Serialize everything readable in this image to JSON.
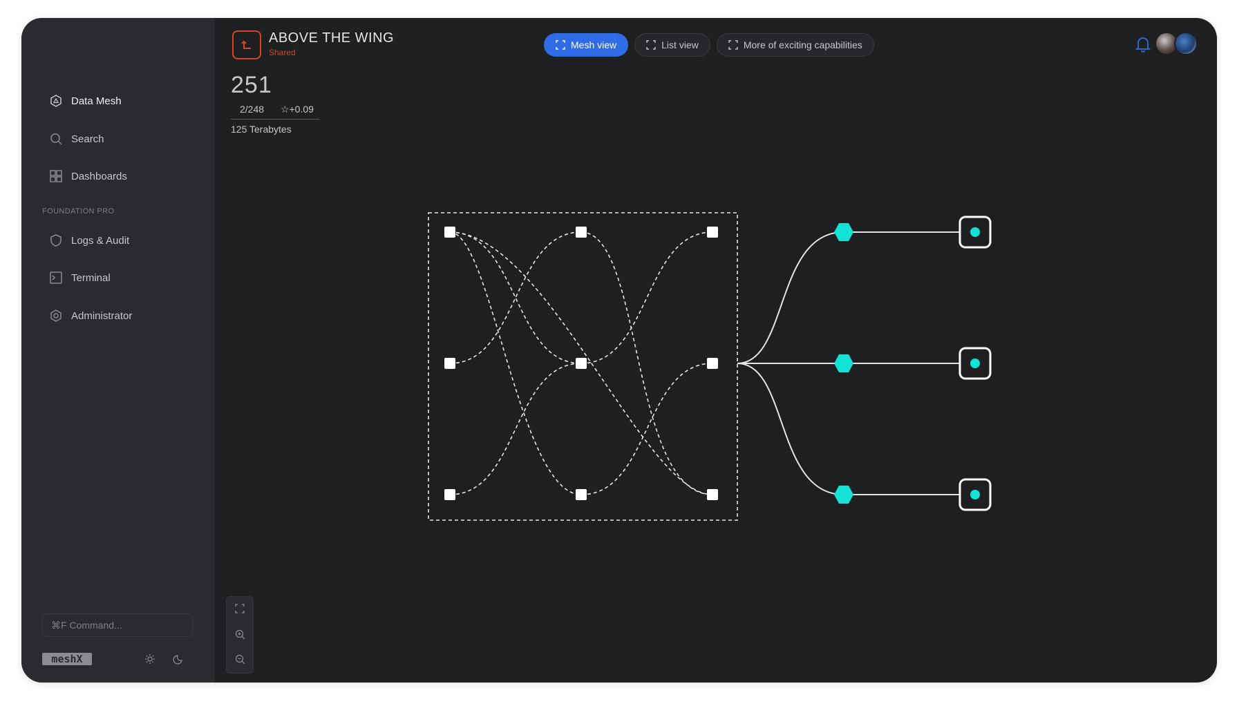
{
  "app": {
    "title": "ABOVE THE WING",
    "subtitle": "Shared",
    "accent_color": "#2f6ce5",
    "brand_color": "#d2452c",
    "node_color": "#14e2d6"
  },
  "sidebar": {
    "items": [
      {
        "label": "Data Mesh",
        "icon": "hexagon-icon",
        "active": true
      },
      {
        "label": "Search",
        "icon": "search-icon"
      },
      {
        "label": "Dashboards",
        "icon": "grid-icon"
      }
    ],
    "section_label": "FOUNDATION PRO",
    "pro_items": [
      {
        "label": "Logs & Audit",
        "icon": "shield-icon"
      },
      {
        "label": "Terminal",
        "icon": "terminal-icon"
      },
      {
        "label": "Administrator",
        "icon": "settings-icon"
      }
    ],
    "command_placeholder": "⌘F  Command...",
    "logo_text": "meshX"
  },
  "tabs": [
    {
      "label": "Mesh view",
      "active": true
    },
    {
      "label": "List view",
      "active": false
    },
    {
      "label": "More of exciting capabilities",
      "active": false
    }
  ],
  "stats": {
    "count": "251",
    "ratio": "2/248",
    "rating": "☆+0.09",
    "storage": "125 Terabytes"
  }
}
